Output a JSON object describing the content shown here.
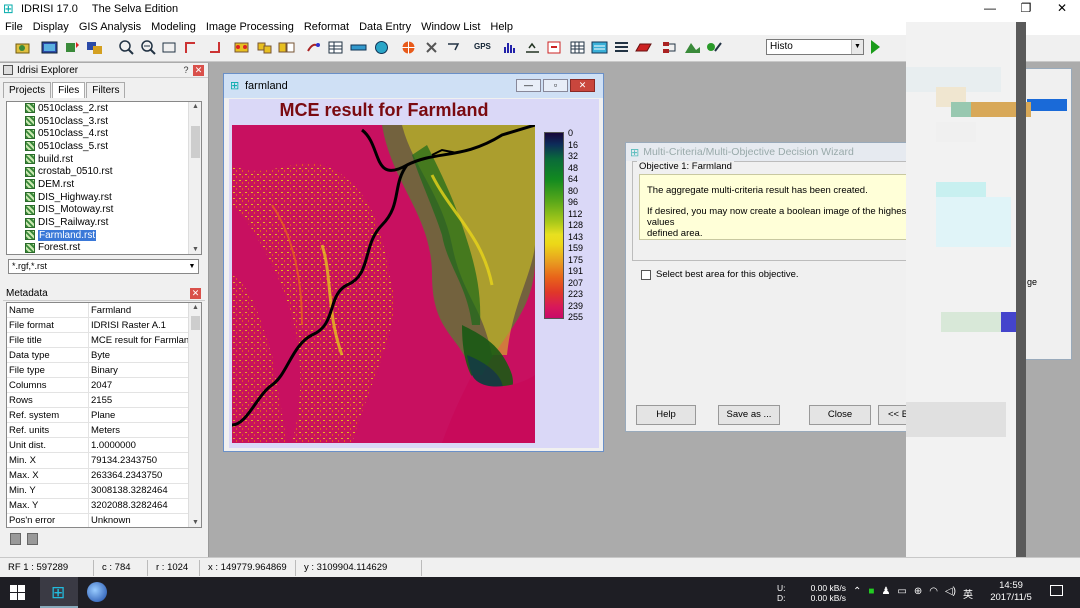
{
  "titlebar": {
    "app_version": "IDRISI 17.0",
    "edition": "The Selva Edition",
    "minimize": "—",
    "maximize": "❐",
    "close": "✕"
  },
  "menubar": [
    "File",
    "Display",
    "GIS Analysis",
    "Modeling",
    "Image Processing",
    "Reformat",
    "Data Entry",
    "Window List",
    "Help"
  ],
  "toolbar": {
    "module_select_value": "Histo"
  },
  "explorer": {
    "title": "Idrisi Explorer",
    "help_glyph": "?",
    "close_glyph": "✕",
    "tabs": [
      "Projects",
      "Files",
      "Filters"
    ],
    "active_tab": "Files",
    "files": [
      "0510class_2.rst",
      "0510class_3.rst",
      "0510class_4.rst",
      "0510class_5.rst",
      "build.rst",
      "crostab_0510.rst",
      "DEM.rst",
      "DIS_Highway.rst",
      "DIS_Motoway.rst",
      "DIS_Railway.rst",
      "Farmland.rst",
      "Forest.rst"
    ],
    "selected_file": "Farmland.rst",
    "filter": "*.rgf,*.rst",
    "metadata_title": "Metadata",
    "metadata": [
      {
        "key": "Name",
        "value": "Farmland"
      },
      {
        "key": "File format",
        "value": "IDRISI Raster A.1"
      },
      {
        "key": "File title",
        "value": "MCE result for Farmland"
      },
      {
        "key": "Data type",
        "value": "Byte"
      },
      {
        "key": "File type",
        "value": "Binary"
      },
      {
        "key": "Columns",
        "value": "2047"
      },
      {
        "key": "Rows",
        "value": "2155"
      },
      {
        "key": "Ref. system",
        "value": "Plane"
      },
      {
        "key": "Ref. units",
        "value": "Meters"
      },
      {
        "key": "Unit dist.",
        "value": "1.0000000"
      },
      {
        "key": "Min. X",
        "value": "79134.2343750"
      },
      {
        "key": "Max. X",
        "value": "263364.2343750"
      },
      {
        "key": "Min. Y",
        "value": "3008138.3282464"
      },
      {
        "key": "Max. Y",
        "value": "3202088.3282464"
      },
      {
        "key": "Pos'n error",
        "value": "Unknown"
      }
    ]
  },
  "map_window": {
    "title": "farmland",
    "map_title": "MCE result for Farmland",
    "legend": [
      "0",
      "16",
      "32",
      "48",
      "64",
      "80",
      "96",
      "112",
      "128",
      "143",
      "159",
      "175",
      "191",
      "207",
      "223",
      "239",
      "255"
    ]
  },
  "wizard": {
    "title": "Multi-Criteria/Multi-Objective Decision Wizard",
    "objective_label": "Objective 1: Farmland",
    "message_1": "The aggregate multi-criteria result has been created.",
    "message_2a": "If desired, you may now create a boolean image of the highest values",
    "message_2b": "defined area.",
    "checkbox_label": "Select best area for this objective.",
    "help_button": "Help",
    "save_button": "Save as ...",
    "close_button": "Close",
    "back_button": "<< Ba"
  },
  "right_window": {
    "partial_text": "ge"
  },
  "statusbar": {
    "rf": "RF  1 : 597289",
    "col": "c : 784",
    "row": "r : 1024",
    "x": "x : 149779.964869",
    "y": "y : 3109904.114629"
  },
  "taskbar": {
    "upload_label": "U:",
    "download_label": "D:",
    "upload_rate": "0.00 kB/s",
    "download_rate": "0.00 kB/s",
    "ime": "英",
    "time": "14:59",
    "date": "2017/11/5"
  },
  "colors": {
    "map_magenta": "#c8145a",
    "map_yellow": "#e8d41a",
    "map_green": "#2a8a20",
    "selection_blue": "#3a78d8",
    "wizard_message_bg": "#ffffd8"
  }
}
